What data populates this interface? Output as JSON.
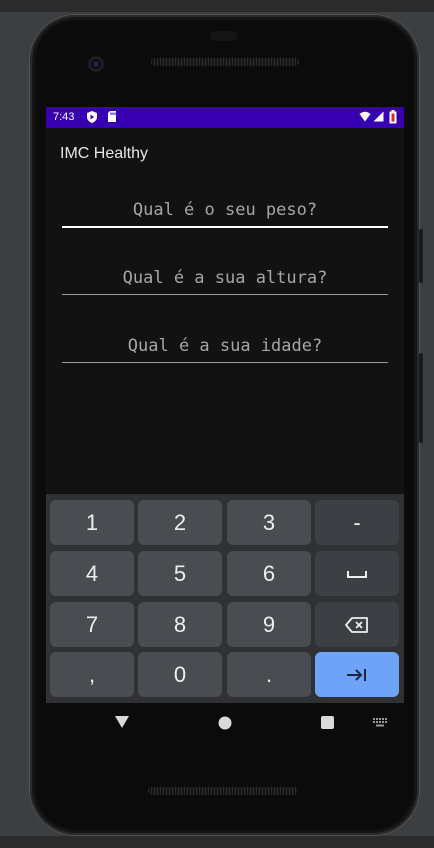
{
  "status_bar": {
    "time": "7:43",
    "icons": [
      "shield-icon",
      "sd-card-icon",
      "wifi-icon",
      "cellular-signal-icon",
      "battery-low-icon"
    ],
    "color": "#3700b3"
  },
  "app": {
    "title": "IMC Healthy"
  },
  "form": {
    "weight": {
      "placeholder": "Qual é o seu peso?",
      "value": ""
    },
    "height": {
      "placeholder": "Qual é a sua altura?",
      "value": ""
    },
    "age": {
      "placeholder": "Qual é a sua idade?",
      "value": ""
    }
  },
  "keyboard": {
    "row1": [
      "1",
      "2",
      "3",
      "-"
    ],
    "row2": [
      "4",
      "5",
      "6",
      "␣"
    ],
    "row3": [
      "7",
      "8",
      "9",
      "⌫"
    ],
    "row4": [
      ",",
      "0",
      ".",
      "⇥"
    ],
    "action_color": "#6fa3f8"
  },
  "nav": {
    "icons": [
      "back-icon",
      "home-icon",
      "recents-icon",
      "keyboard-switch-icon"
    ]
  }
}
